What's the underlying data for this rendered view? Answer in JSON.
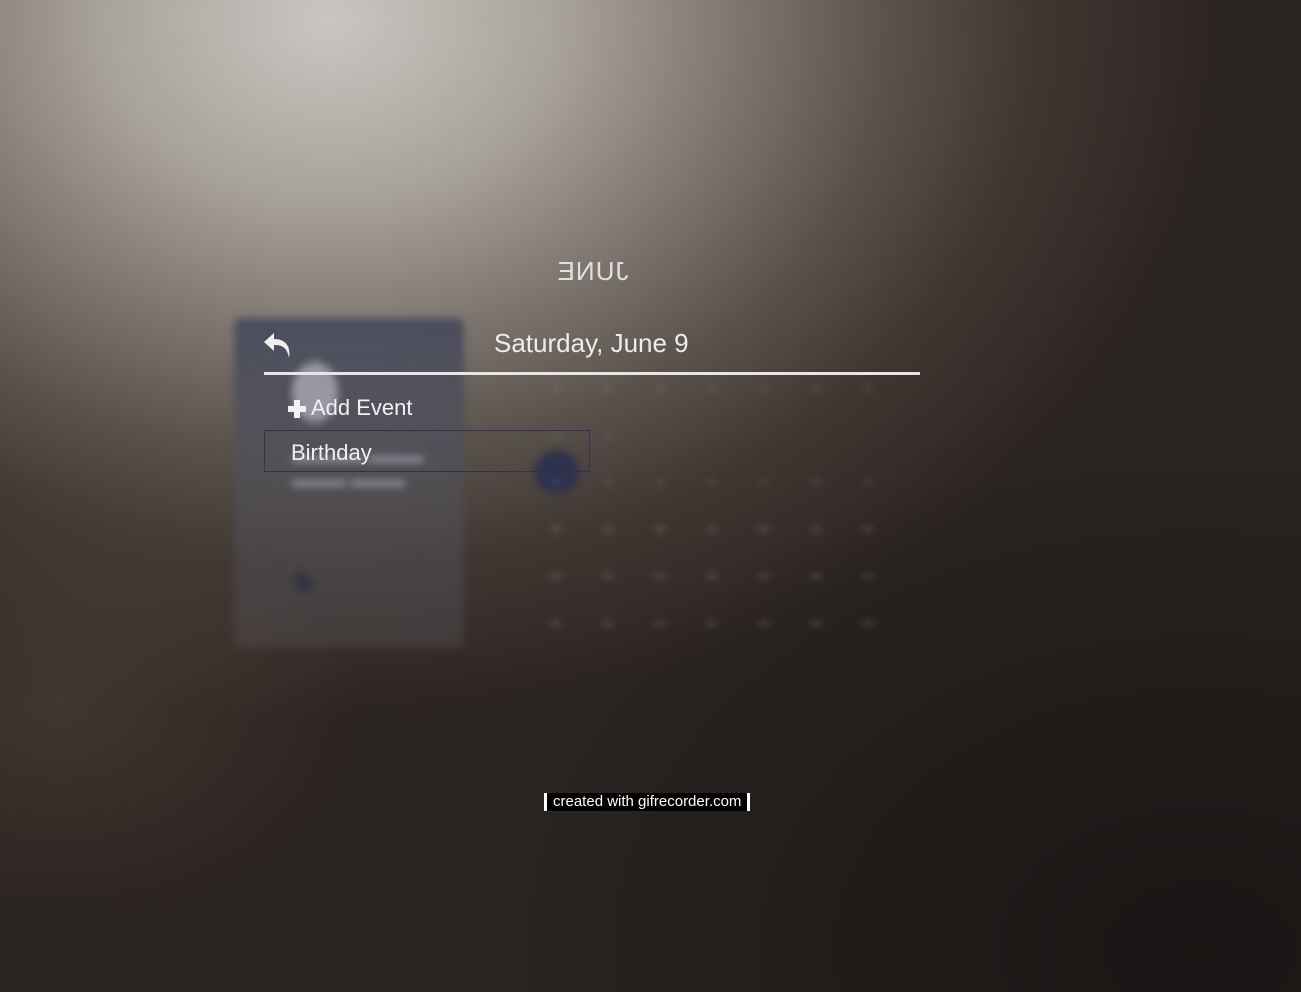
{
  "calendar": {
    "month_title": "JUNE",
    "selected_day": "Saturday, June 9",
    "add_event_label": "Add Event",
    "events": [
      {
        "title": "Birthday"
      }
    ]
  },
  "watermark": {
    "text": "created with gifrecorder.com"
  },
  "colors": {
    "event_border": "#2c3256",
    "header_line": "#e6e6e6",
    "text": "#f0f0f0"
  },
  "icons": {
    "back": "back-arrow-icon",
    "add": "plus-icon"
  }
}
